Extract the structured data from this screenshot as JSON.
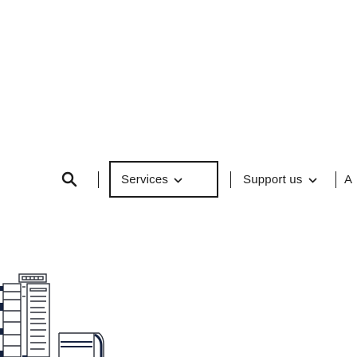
{
  "nav": {
    "search": {
      "icon": "search-icon"
    },
    "items": [
      {
        "label": "Services",
        "icon": "chevron-down-icon",
        "active": true
      },
      {
        "label": "Support us",
        "icon": "chevron-down-icon",
        "active": false
      },
      {
        "label": "A",
        "icon": "",
        "active": false
      }
    ]
  },
  "colors": {
    "text": "#1b1b1b",
    "border": "#1b1b1b",
    "background": "#ffffff",
    "illustration_line": "#2b2f38",
    "illustration_accent": "#14213f"
  }
}
